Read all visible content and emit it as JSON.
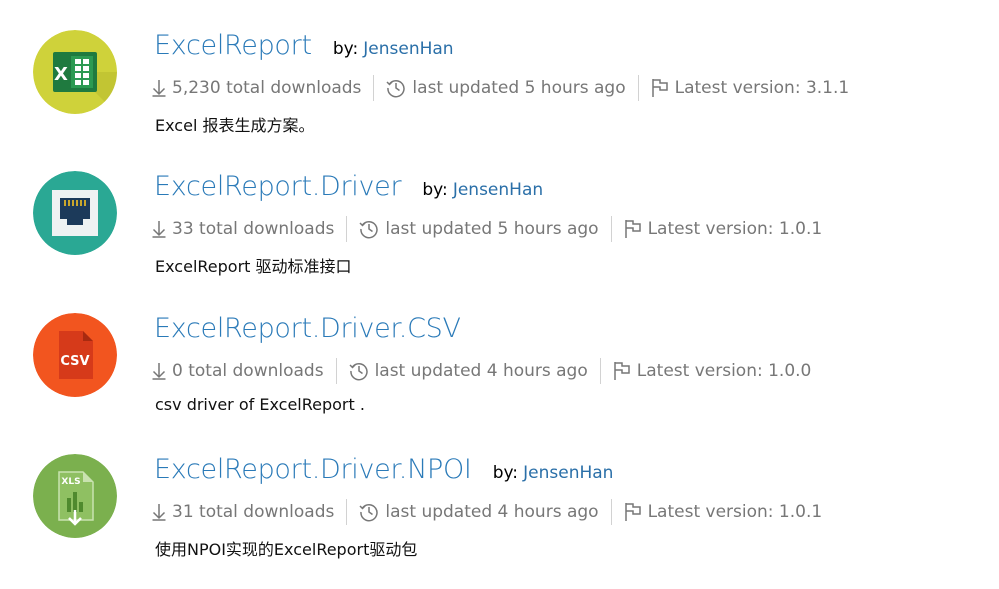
{
  "packages": [
    {
      "title": "ExcelReport",
      "by_label": "by:",
      "author": "JensenHan",
      "downloads": "5,230 total downloads",
      "updated": "last updated 5 hours ago",
      "version": "Latest version: 3.1.1",
      "description": "Excel 报表生成方案。",
      "icon": "excel-icon",
      "icon_bg": "#c8c93a",
      "icon_fg": "#1f7a3f"
    },
    {
      "title": "ExcelReport.Driver",
      "by_label": "by:",
      "author": "JensenHan",
      "downloads": "33 total downloads",
      "updated": "last updated 5 hours ago",
      "version": "Latest version: 1.0.1",
      "description": "ExcelReport 驱动标准接口",
      "icon": "ethernet-port-icon",
      "icon_bg": "#2aa894",
      "icon_fg": "#1c3a5a"
    },
    {
      "title": "ExcelReport.Driver.CSV",
      "by_label": "",
      "author": "",
      "downloads": "0 total downloads",
      "updated": "last updated 4 hours ago",
      "version": "Latest version: 1.0.0",
      "description": "csv driver of ExcelReport .",
      "icon": "csv-file-icon",
      "icon_label": "CSV",
      "icon_bg": "#f2551f",
      "icon_fg": "#d63a1a"
    },
    {
      "title": "ExcelReport.Driver.NPOI",
      "by_label": "by:",
      "author": "JensenHan",
      "downloads": "31 total downloads",
      "updated": "last updated 4 hours ago",
      "version": "Latest version: 1.0.1",
      "description": "使用NPOI实现的ExcelReport驱动包",
      "icon": "xls-file-icon",
      "icon_label": "XLS",
      "icon_bg": "#7bb04e",
      "icon_fg": "#4f8a2e"
    }
  ]
}
